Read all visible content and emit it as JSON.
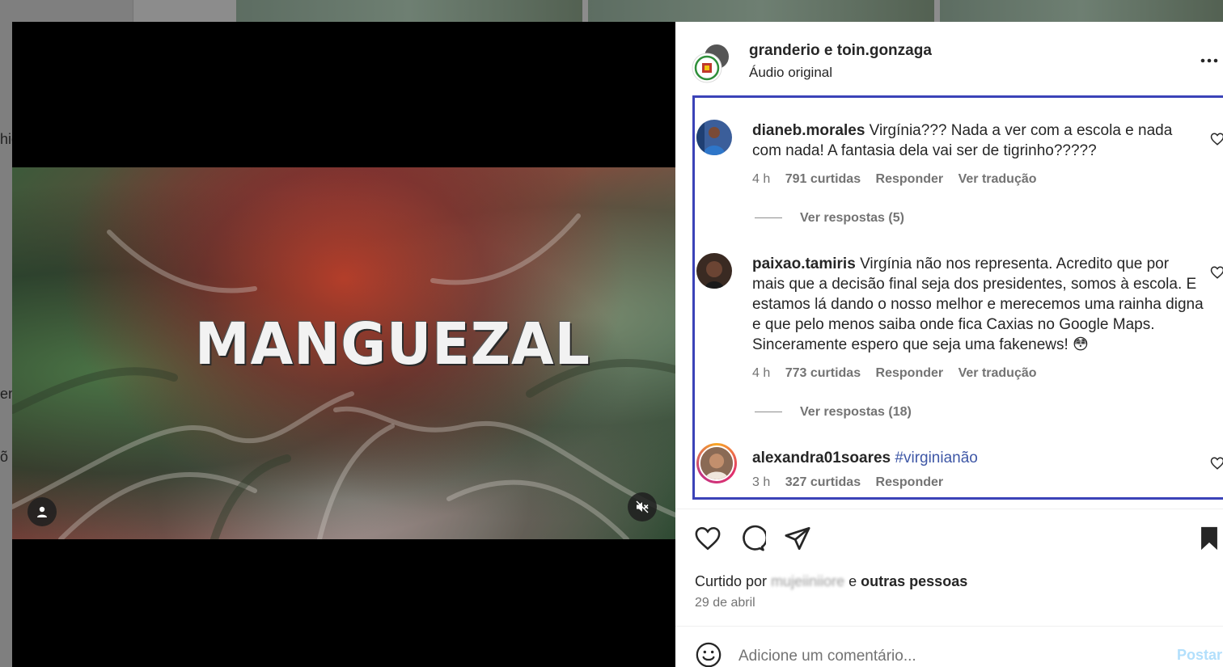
{
  "background": {
    "sidebar_fragments": [
      "hic",
      "en",
      "õ"
    ]
  },
  "post": {
    "author_names": "granderio e toin.gonzaga",
    "audio_label": "Áudio original",
    "more_icon": "more-horizontal-icon",
    "video": {
      "title_text": "MANGUEZAL"
    }
  },
  "comments": [
    {
      "username": "dianeb.morales",
      "text": "Virgínia??? Nada a ver com a escola e nada com nada! A fantasia dela vai ser de tigrinho?????",
      "time": "4 h",
      "likes": "791 curtidas",
      "reply_label": "Responder",
      "translate_label": "Ver tradução",
      "view_replies": "Ver respostas (5)"
    },
    {
      "username": "paixao.tamiris",
      "text": "Virgínia não nos representa. Acredito que por mais que a decisão final seja dos presidentes, somos à escola. E estamos lá dando o nosso melhor e merecemos uma rainha digna e que pelo menos saiba onde fica Caxias no Google Maps. Sinceramente espero que seja uma fakenews! 😳",
      "time": "4 h",
      "likes": "773 curtidas",
      "reply_label": "Responder",
      "translate_label": "Ver tradução",
      "view_replies": "Ver respostas (18)"
    },
    {
      "username": "alexandra01soares",
      "hashtag": "#virginianão",
      "time": "3 h",
      "likes": "327 curtidas",
      "reply_label": "Responder"
    }
  ],
  "liked_by": {
    "prefix": "Curtido por",
    "blurred_user": "mujeiiniiore",
    "connector": "e",
    "others": "outras pessoas"
  },
  "post_date": "29 de abril",
  "comment_box": {
    "placeholder": "Adicione um comentário...",
    "post_label": "Postar"
  },
  "colors": {
    "highlight_border": "#3b43b8",
    "hashtag": "#3e57a6",
    "post_button_disabled": "#b2dffc"
  }
}
